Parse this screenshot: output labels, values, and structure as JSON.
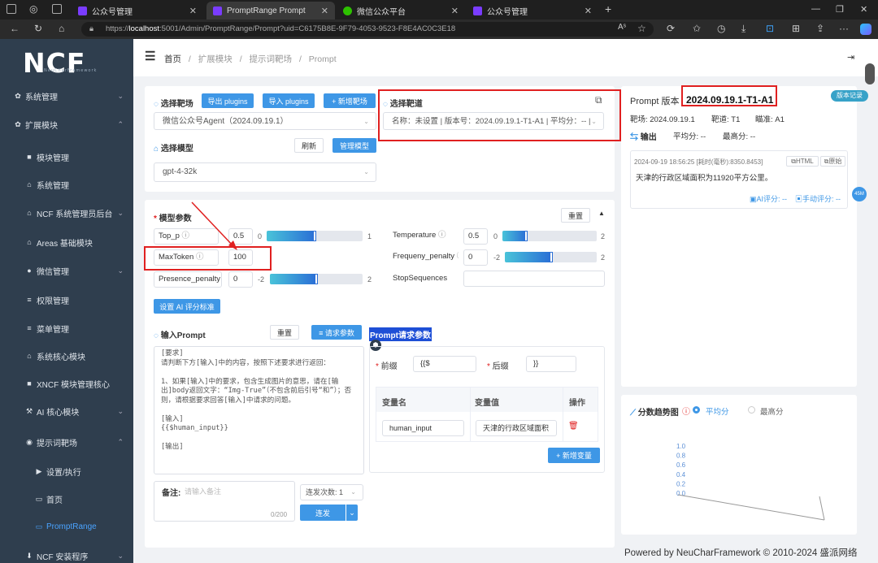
{
  "browser": {
    "tabs": [
      {
        "label": "公众号管理",
        "color": "#7a3cff"
      },
      {
        "label": "PromptRange Prompt",
        "color": "#7a3cff"
      },
      {
        "label": "微信公众平台",
        "color": "#2dc100"
      },
      {
        "label": "公众号管理",
        "color": "#7a3cff"
      }
    ],
    "new_tab": "+",
    "url_prefix": "https://",
    "url_host": "localhost",
    "url_rest": ":5001/Admin/PromptRange/Prompt?uid=C6175B8E-9F79-4053-9523-F8E4AC0C3E18"
  },
  "sidebar": {
    "logo": "NCF",
    "logo_sub": "NeuCharFramework",
    "items": [
      {
        "label": "系统管理",
        "icon": "gear-icon",
        "glyph": "✿",
        "level": 0,
        "chevron": "⌄"
      },
      {
        "label": "扩展模块",
        "icon": "gear-icon",
        "glyph": "✿",
        "level": 0,
        "chevron": "⌃"
      },
      {
        "label": "模块管理",
        "icon": "lock-icon",
        "glyph": "■",
        "level": 1,
        "chevron": ""
      },
      {
        "label": "系统管理",
        "icon": "bank-icon",
        "glyph": "⌂",
        "level": 1,
        "chevron": ""
      },
      {
        "label": "NCF 系统管理员后台",
        "icon": "bank-icon",
        "glyph": "⌂",
        "level": 1,
        "chevron": "⌄"
      },
      {
        "label": "Areas 基础模块",
        "icon": "bank-icon",
        "glyph": "⌂",
        "level": 1,
        "chevron": ""
      },
      {
        "label": "微信管理",
        "icon": "wechat-icon",
        "glyph": "●",
        "level": 1,
        "chevron": "⌄"
      },
      {
        "label": "权限管理",
        "icon": "list-icon",
        "glyph": "≡",
        "level": 1,
        "chevron": ""
      },
      {
        "label": "菜单管理",
        "icon": "list-icon",
        "glyph": "≡",
        "level": 1,
        "chevron": ""
      },
      {
        "label": "系统核心模块",
        "icon": "bank-icon",
        "glyph": "⌂",
        "level": 1,
        "chevron": ""
      },
      {
        "label": "XNCF 模块管理核心",
        "icon": "lock-icon",
        "glyph": "■",
        "level": 1,
        "chevron": ""
      },
      {
        "label": "AI 核心模块",
        "icon": "magic-icon",
        "glyph": "⚒",
        "level": 1,
        "chevron": "⌄"
      },
      {
        "label": "提示词靶场",
        "icon": "circle-icon",
        "glyph": "◉",
        "level": 1,
        "chevron": "⌃"
      },
      {
        "label": "设置/执行",
        "icon": "play-icon",
        "glyph": "▶",
        "level": 2,
        "chevron": ""
      },
      {
        "label": "首页",
        "icon": "monitor-icon",
        "glyph": "▭",
        "level": 2,
        "chevron": ""
      },
      {
        "label": "PromptRange",
        "icon": "monitor-icon",
        "glyph": "▭",
        "level": 2,
        "chevron": "",
        "active": true
      },
      {
        "label": "NCF 安装程序",
        "icon": "download-icon",
        "glyph": "⬇",
        "level": 1,
        "chevron": "⌄"
      }
    ]
  },
  "breadcrumb": {
    "items": [
      "首页",
      "扩展模块",
      "提示词靶场",
      "Prompt"
    ],
    "sep": "/"
  },
  "target": {
    "label": "选择靶场",
    "export_btn": "导出 plugins",
    "import_btn": "导入 plugins",
    "new_btn": "+ 新增靶场",
    "value": "微信公众号Agent（2024.09.19.1）"
  },
  "model": {
    "label": "选择模型",
    "refresh_btn": "刷新",
    "manage_btn": "管理模型",
    "value": "gpt-4-32k"
  },
  "lane": {
    "label": "选择靶道",
    "value": "名称：未设置 | 版本号：2024.09.19.1-T1-A1 | 平均分：-- |"
  },
  "params": {
    "title": "模型参数",
    "reset_btn": "重置",
    "rows": [
      {
        "name": "Top_p",
        "value": "0.5",
        "min": "0",
        "max": "1",
        "fraction": 0.5
      },
      {
        "name": "Temperature",
        "value": "0.5",
        "min": "0",
        "max": "2",
        "fraction": 0.25
      },
      {
        "name": "MaxToken",
        "value": "100"
      },
      {
        "name": "Frequeny_penalty",
        "value": "0",
        "min": "-2",
        "max": "2",
        "fraction": 0.5
      },
      {
        "name": "Presence_penalty",
        "value": "0",
        "min": "-2",
        "max": "2",
        "fraction": 0.5
      },
      {
        "name": "StopSequences",
        "value": ""
      }
    ],
    "ai_score_btn": "设置 AI 评分标准"
  },
  "prompt": {
    "label": "输入Prompt",
    "reset_btn": "重置",
    "request_btn": "≡ 请求参数",
    "text": "[要求]\n请判断下方[输入]中的内容，按照下述要求进行返回：\n\n1、如果[输入]中的要求，包含生成图片的意思，请在[输出]body返回文字：“Img-True”（不包含前后引号“和”）；否则，请根据要求回答[输入]中请求的问题。\n\n[输入]\n{{$human_input}}\n\n[输出]",
    "note_label": "备注:",
    "note_placeholder": "请输入备注",
    "note_count": "0/200",
    "repeat_label": "连发次数: 1",
    "send_btn": "连发"
  },
  "request_params": {
    "title": "Prompt请求参数",
    "prefix_label": "前缀",
    "prefix_value": "{{$",
    "suffix_label": "后缀",
    "suffix_value": "}}",
    "col_name": "变量名",
    "col_value": "变量值",
    "col_op": "操作",
    "rows": [
      {
        "name": "human_input",
        "value": "天津的行政区域面积"
      }
    ],
    "add_btn": "+ 新增变量"
  },
  "version": {
    "label": "Prompt 版本",
    "value": "2024.09.19.1-T1-A1",
    "history_btn": "版本记录",
    "range_label": "靶场: 2024.09.19.1",
    "lane_label": "靶道: T1",
    "arm_label": "瞄准: A1",
    "output_label": "输出",
    "avg_label": "平均分: --",
    "max_label": "最高分: --",
    "result_time": "2024-09-19 18:56:25 [耗时(毫秒):8350.8453]",
    "html_btn": "HTML",
    "raw_btn": "原始",
    "result_text": "天津的行政区域面积为11920平方公里。",
    "ai_score": "AI评分: --",
    "manual_score": "手动评分: --",
    "float_badge": "45M"
  },
  "trend": {
    "title": "分数趋势图",
    "opt_avg": "平均分",
    "opt_max": "最高分",
    "chart_data": {
      "type": "line",
      "y_ticks": [
        "1.0",
        "0.8",
        "0.6",
        "0.4",
        "0.2",
        "0.0"
      ],
      "ylim": [
        0,
        1
      ]
    }
  },
  "footer": "Powered by NeuCharFramework © 2010-2024 盛派网络"
}
